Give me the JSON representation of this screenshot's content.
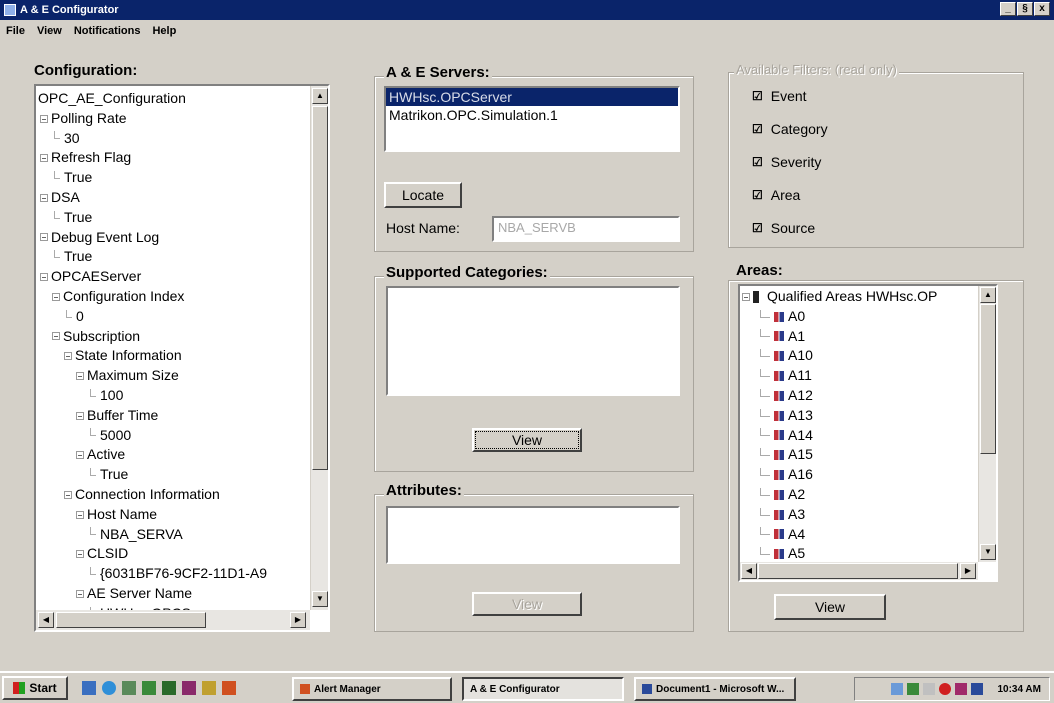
{
  "window": {
    "title": "A & E Configurator",
    "controls": [
      "_",
      "§",
      "x"
    ]
  },
  "menu": [
    "File",
    "View",
    "Notifications",
    "Help"
  ],
  "configuration": {
    "label": "Configuration:",
    "tree": [
      {
        "text": "OPC_AE_Configuration",
        "level": 0,
        "kind": "root"
      },
      {
        "text": "Polling Rate",
        "level": 0,
        "kind": "node"
      },
      {
        "text": "30",
        "level": 1,
        "kind": "leaf"
      },
      {
        "text": "Refresh Flag",
        "level": 0,
        "kind": "node"
      },
      {
        "text": "True",
        "level": 1,
        "kind": "leaf"
      },
      {
        "text": "DSA",
        "level": 0,
        "kind": "node"
      },
      {
        "text": "True",
        "level": 1,
        "kind": "leaf"
      },
      {
        "text": "Debug Event Log",
        "level": 0,
        "kind": "node"
      },
      {
        "text": "True",
        "level": 1,
        "kind": "leaf"
      },
      {
        "text": "OPCAEServer",
        "level": 0,
        "kind": "node"
      },
      {
        "text": "Configuration Index",
        "level": 1,
        "kind": "node"
      },
      {
        "text": "0",
        "level": 2,
        "kind": "leaf"
      },
      {
        "text": "Subscription",
        "level": 1,
        "kind": "node"
      },
      {
        "text": "State Information",
        "level": 2,
        "kind": "node"
      },
      {
        "text": "Maximum Size",
        "level": 3,
        "kind": "node"
      },
      {
        "text": "100",
        "level": 4,
        "kind": "leaf"
      },
      {
        "text": "Buffer Time",
        "level": 3,
        "kind": "node"
      },
      {
        "text": "5000",
        "level": 4,
        "kind": "leaf"
      },
      {
        "text": "Active",
        "level": 3,
        "kind": "node"
      },
      {
        "text": "True",
        "level": 4,
        "kind": "leaf"
      },
      {
        "text": "Connection Information",
        "level": 2,
        "kind": "node"
      },
      {
        "text": "Host Name",
        "level": 3,
        "kind": "node"
      },
      {
        "text": "NBA_SERVA",
        "level": 4,
        "kind": "leaf"
      },
      {
        "text": "CLSID",
        "level": 3,
        "kind": "node"
      },
      {
        "text": "{6031BF76-9CF2-11D1-A9",
        "level": 4,
        "kind": "leaf"
      },
      {
        "text": "AE Server Name",
        "level": 3,
        "kind": "node"
      },
      {
        "text": "HWHsc.OPCServer",
        "level": 4,
        "kind": "leaf"
      }
    ]
  },
  "servers": {
    "label": "A & E Servers:",
    "items": [
      "HWHsc.OPCServer",
      "Matrikon.OPC.Simulation.1"
    ],
    "selected_index": 0,
    "locate_label": "Locate",
    "host_label": "Host Name:",
    "host_value": "NBA_SERVB"
  },
  "categories": {
    "label": "Supported Categories:",
    "view_label": "View"
  },
  "attributes": {
    "label": "Attributes:",
    "view_label": "View"
  },
  "filters": {
    "label": "Available Filters: (read only)",
    "items": [
      {
        "label": "Event",
        "checked": true
      },
      {
        "label": "Category",
        "checked": true
      },
      {
        "label": "Severity",
        "checked": true
      },
      {
        "label": "Area",
        "checked": true
      },
      {
        "label": "Source",
        "checked": true
      }
    ]
  },
  "areas": {
    "label": "Areas:",
    "root": "Qualified Areas HWHsc.OP",
    "items": [
      "A0",
      "A1",
      "A10",
      "A11",
      "A12",
      "A13",
      "A14",
      "A15",
      "A16",
      "A2",
      "A3",
      "A4",
      "A5"
    ],
    "view_label": "View"
  },
  "taskbar": {
    "start": "Start",
    "tasks": [
      "Alert Manager",
      "A & E Configurator",
      "Document1 - Microsoft W..."
    ],
    "active_index": 1,
    "clock": "10:34 AM"
  },
  "colors": {
    "selection": "#0a246a",
    "titlebar": "#0a246a",
    "face": "#d4d0c8"
  }
}
